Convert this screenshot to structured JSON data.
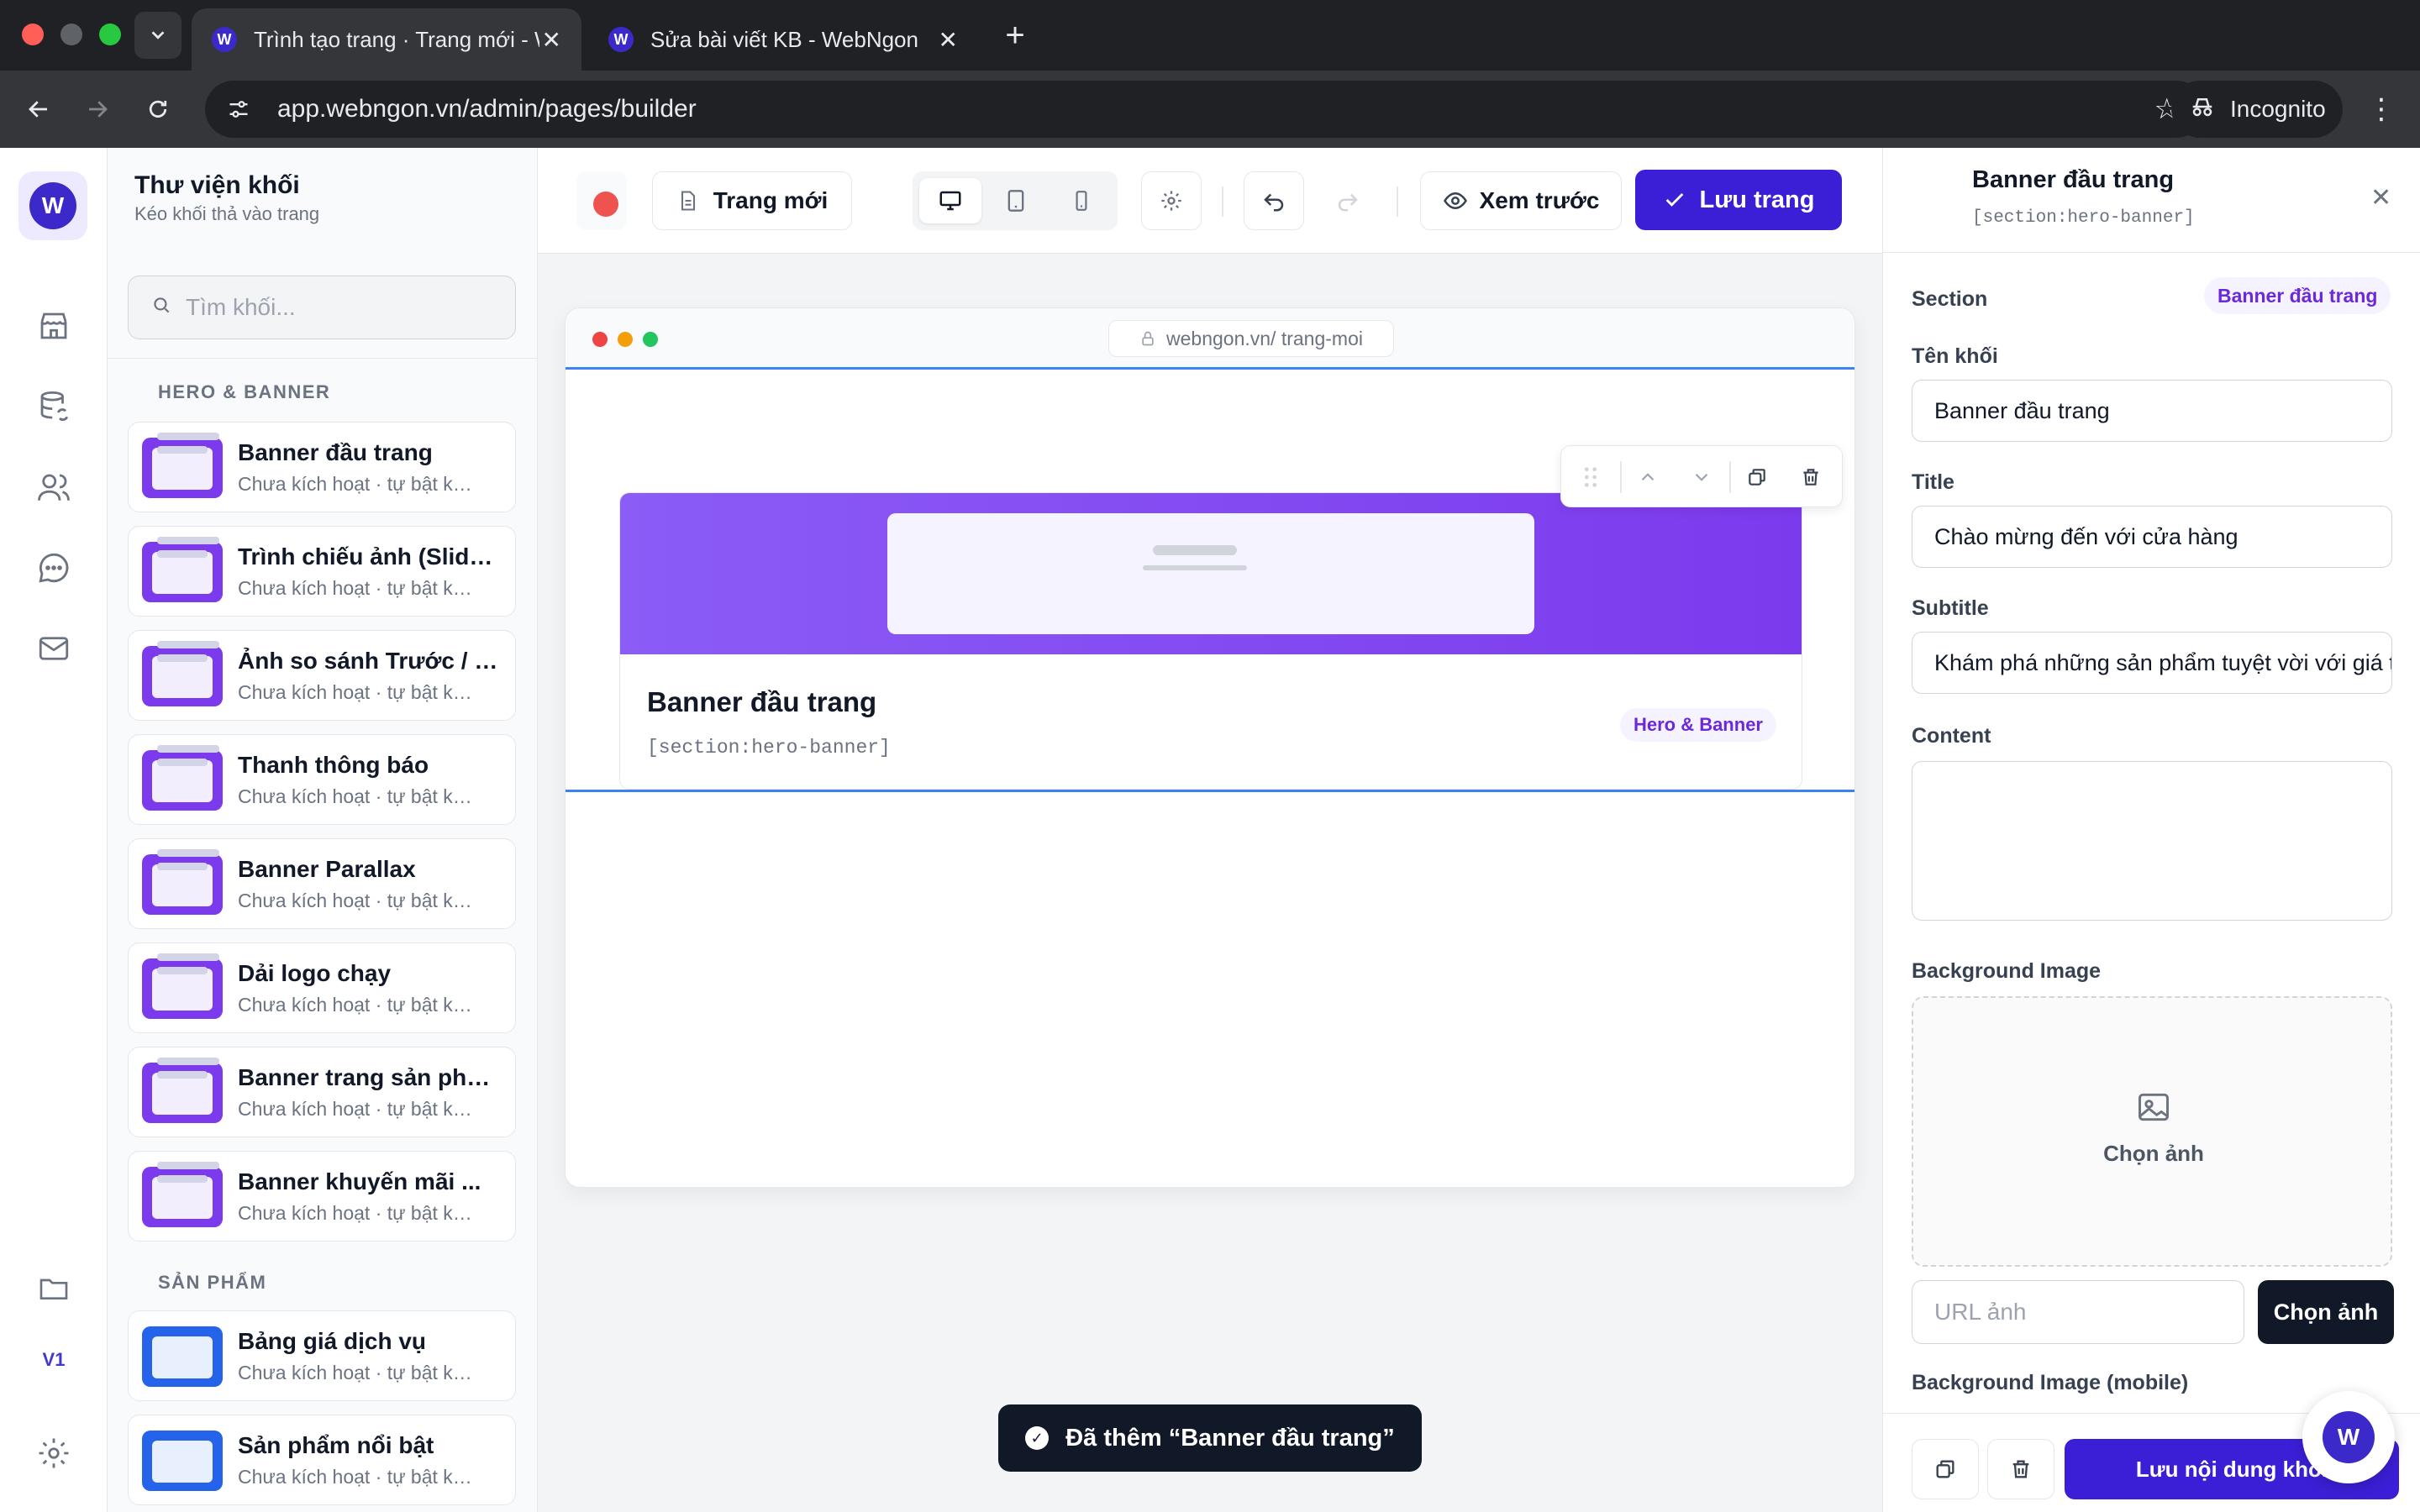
{
  "browser": {
    "tabs": [
      {
        "title": "Trình tạo trang · Trang mới - WebNgon",
        "active": true
      },
      {
        "title": "Sửa bài viết KB - WebNgon",
        "active": false
      }
    ],
    "url": "app.webngon.vn/admin/pages/builder",
    "incognito_label": "Incognito"
  },
  "rail": {
    "logo": "W",
    "items": [
      "store-icon",
      "database-sync-icon",
      "users-icon",
      "chat-icon",
      "mail-icon",
      "folder-icon",
      "settings-icon"
    ],
    "version": "V1"
  },
  "library": {
    "title": "Thư viện khối",
    "subtitle": "Kéo khối thả vào trang",
    "search_placeholder": "Tìm khối...",
    "groups": [
      {
        "label": "HERO & BANNER",
        "blocks": [
          {
            "name": "Banner đầu trang",
            "sub": "Chưa kích hoạt · tự bật khi thêm"
          },
          {
            "name": "Trình chiếu ảnh (Slideshow)",
            "sub": "Chưa kích hoạt · tự bật khi thêm"
          },
          {
            "name": "Ảnh so sánh Trước / Sau",
            "sub": "Chưa kích hoạt · tự bật khi thêm"
          },
          {
            "name": "Thanh thông báo",
            "sub": "Chưa kích hoạt · tự bật khi thêm"
          },
          {
            "name": "Banner Parallax",
            "sub": "Chưa kích hoạt · tự bật khi thêm"
          },
          {
            "name": "Dải logo chạy",
            "sub": "Chưa kích hoạt · tự bật khi thêm"
          },
          {
            "name": "Banner trang sản phẩm",
            "sub": "Chưa kích hoạt · tự bật khi thêm"
          },
          {
            "name": "Banner khuyến mãi ...",
            "sub": "Chưa kích hoạt · tự bật khi thêm"
          }
        ]
      },
      {
        "label": "SẢN PHẨM",
        "blocks": [
          {
            "name": "Bảng giá dịch vụ",
            "sub": "Chưa kích hoạt · tự bật khi thêm"
          },
          {
            "name": "Sản phẩm nổi bật",
            "sub": "Chưa kích hoạt · tự bật khi thêm"
          }
        ]
      }
    ]
  },
  "editor": {
    "page_name": "Trang mới",
    "preview_label": "Xem trước",
    "save_label": "Lưu trang",
    "devices": [
      "desktop-icon",
      "tablet-icon",
      "mobile-icon"
    ],
    "active_device": "desktop"
  },
  "canvas": {
    "address": "webngon.vn/ trang-moi",
    "section": {
      "title": "Banner đầu trang",
      "tag": "[section:hero-banner]",
      "category": "Hero & Banner"
    }
  },
  "toast": {
    "message": "Đã thêm “Banner đầu trang”"
  },
  "panel": {
    "title": "Banner đầu trang",
    "tag": "[section:hero-banner]",
    "section_label": "Section",
    "section_badge": "Banner đầu trang",
    "fields": {
      "block_name": {
        "label": "Tên khối",
        "value": "Banner đầu trang"
      },
      "title": {
        "label": "Title",
        "value": "Chào mừng đến với cửa hàng"
      },
      "subtitle": {
        "label": "Subtitle",
        "value": "Khám phá những sản phẩm tuyệt vời với giá tốt nhất"
      },
      "content": {
        "label": "Content",
        "value": ""
      },
      "bg_image": {
        "label": "Background Image",
        "drop_label": "Chọn ảnh",
        "url_placeholder": "URL ảnh",
        "pick_label": "Chọn ảnh"
      },
      "bg_image_mobile": {
        "label": "Background Image (mobile)"
      }
    },
    "save_content_label": "Lưu nội dung khối"
  },
  "colors": {
    "accent": "#3b1fd6",
    "selection": "#3b82f6",
    "hero": "#7c3aed"
  }
}
